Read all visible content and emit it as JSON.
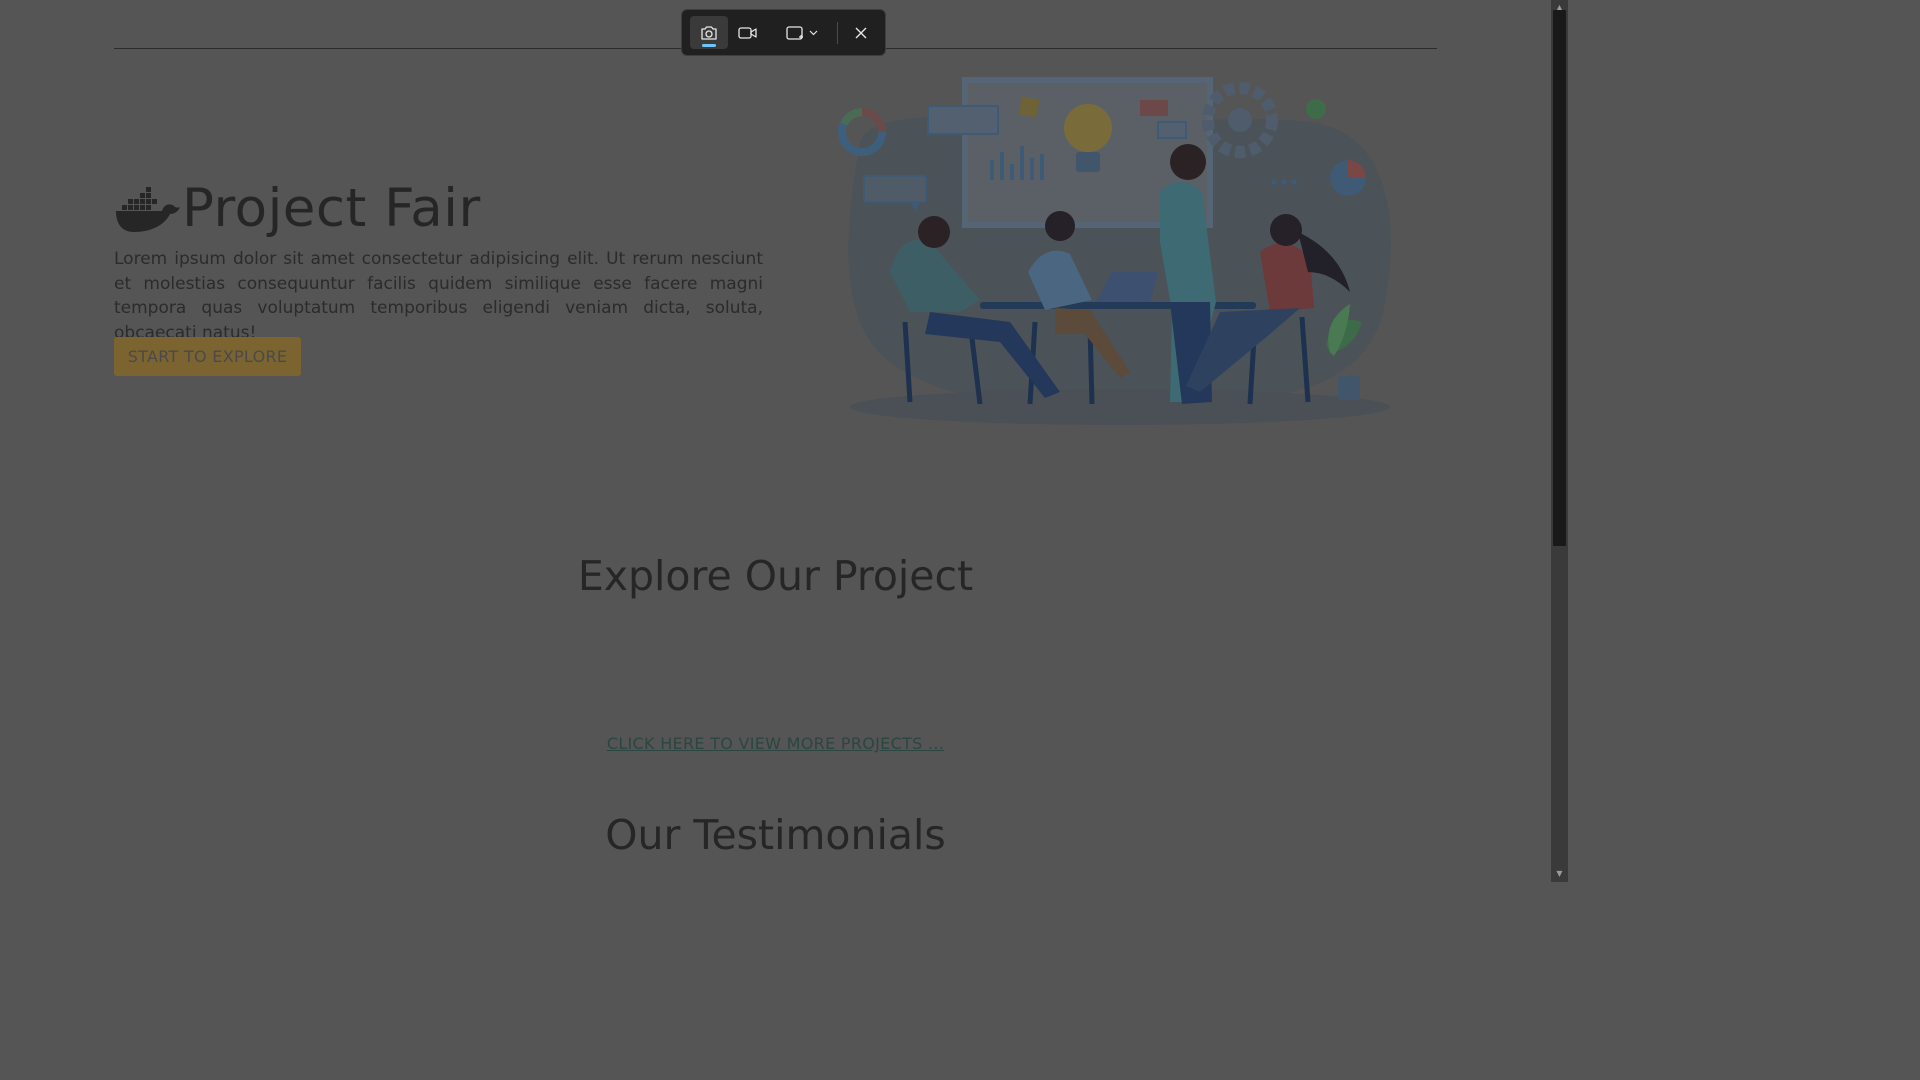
{
  "hero": {
    "title": "Project Fair",
    "description": "Lorem ipsum dolor sit amet consectetur adipisicing elit. Ut rerum nesciunt et molestias consequuntur facilis quidem similique esse facere magni tempora quas voluptatum temporibus eligendi veniam dicta, soluta, obcaecati natus!",
    "cta_label": "START TO EXPLORE"
  },
  "sections": {
    "explore_title": "Explore Our Project",
    "more_projects_link": "CLICK HERE TO VIEW MORE PROJECTS ...",
    "testimonials_title": "Our Testimonials"
  },
  "snipping_toolbar": {
    "mode": "screenshot",
    "buttons": [
      "camera-icon",
      "video-icon",
      "rectangle-mode-icon",
      "close-icon"
    ]
  },
  "colors": {
    "overlay_background": "#555555",
    "cta_background": "#7b6430",
    "link": "#2b4640",
    "toolbar_background": "#202020",
    "toolbar_active_indicator": "#6ec5f7"
  }
}
